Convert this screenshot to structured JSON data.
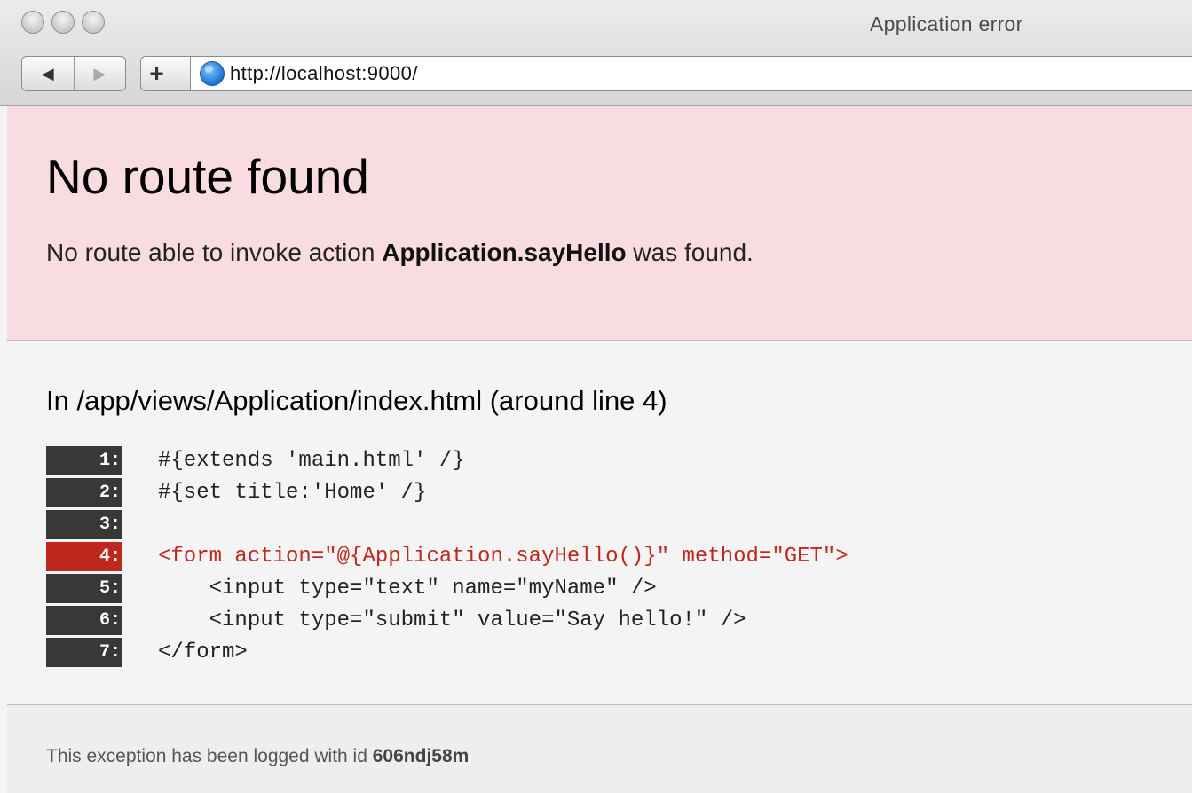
{
  "window": {
    "title": "Application error"
  },
  "toolbar": {
    "back_icon": "◀",
    "forward_icon": "▶",
    "add_icon": "+",
    "url": "http://localhost:9000/"
  },
  "error": {
    "title": "No route found",
    "message_prefix": "No route able to invoke action ",
    "action": "Application.sayHello",
    "message_suffix": " was found."
  },
  "source": {
    "title": "In /app/views/Application/index.html (around line 4)",
    "highlight_line": 4,
    "lines": [
      {
        "num": "1:",
        "code": "#{extends 'main.html' /}"
      },
      {
        "num": "2:",
        "code": "#{set title:'Home' /}"
      },
      {
        "num": "3:",
        "code": ""
      },
      {
        "num": "4:",
        "code": "<form action=\"@{Application.sayHello()}\" method=\"GET\">"
      },
      {
        "num": "5:",
        "code": "    <input type=\"text\" name=\"myName\" />"
      },
      {
        "num": "6:",
        "code": "    <input type=\"submit\" value=\"Say hello!\" />"
      },
      {
        "num": "7:",
        "code": "</form>"
      }
    ]
  },
  "footer": {
    "prefix": "This exception has been logged with id ",
    "log_id": "606ndj58m"
  },
  "colors": {
    "error_background": "#f9dce2",
    "highlight_line": "#c0281e",
    "line_number_background": "#383838"
  }
}
